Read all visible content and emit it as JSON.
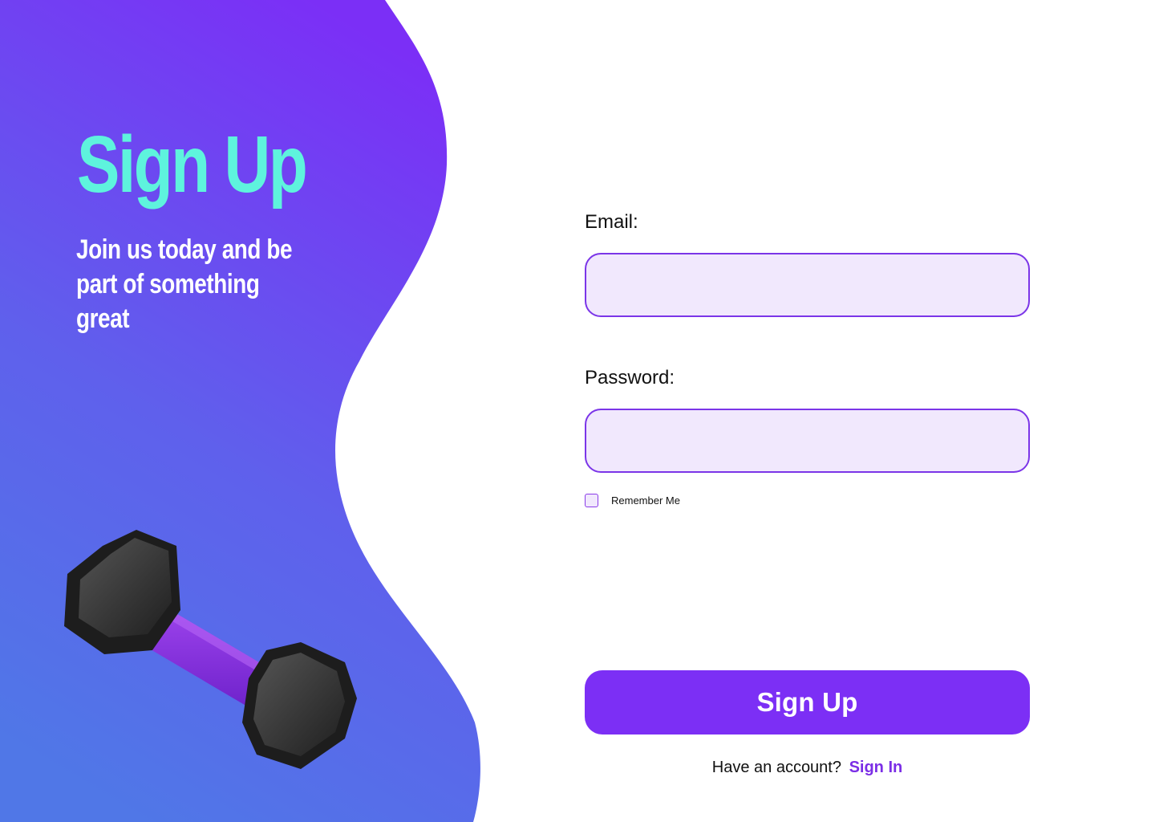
{
  "hero": {
    "title": "Sign Up",
    "subtitle": "Join us today and be part of something great"
  },
  "form": {
    "email_label": "Email:",
    "email_value": "",
    "password_label": "Password:",
    "password_value": "",
    "remember_label": "Remember Me",
    "remember_checked": false,
    "submit_label": "Sign Up",
    "account_prompt": "Have an account?",
    "sign_in_link": "Sign In"
  },
  "colors": {
    "gradient_top": "#7b2ff6",
    "gradient_bottom": "#5077e7",
    "title_accent": "#5ef3dd",
    "button": "#7c2ff5",
    "input_fill": "#f1e8fd",
    "input_border": "#7b35e8",
    "link": "#7b2ee6"
  },
  "icons": {
    "hero_image": "dumbbell-icon"
  }
}
